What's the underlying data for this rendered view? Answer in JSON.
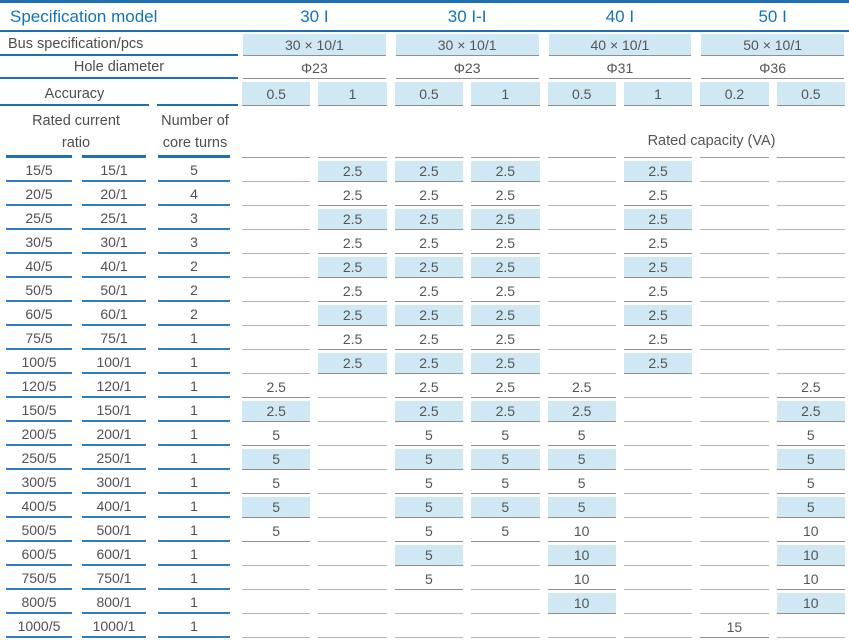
{
  "colors": {
    "accent_blue": "#1273b9",
    "line_blue": "#1f6fb2",
    "cell_bg": "#cfe8f3",
    "line_gray": "#8f8f8f",
    "line_gray_light": "#b5b5b5",
    "text_dark": "#4d4d4d"
  },
  "table": {
    "title": "Specification model",
    "models": [
      "30 I",
      "30 I-I",
      "40 I",
      "50 I"
    ],
    "bus_label": "Bus specification/pcs",
    "bus_values": [
      "30 × 10/1",
      "30 × 10/1",
      "40 × 10/1",
      "50 × 10/1"
    ],
    "hole_label": "Hole diameter",
    "hole_values": [
      "Φ23",
      "Φ23",
      "Φ31",
      "Φ36"
    ],
    "accuracy_label": "Accuracy",
    "accuracy_values": [
      "0.5",
      "1",
      "0.5",
      "1",
      "0.5",
      "1",
      "0.2",
      "0.5"
    ],
    "ratio_header": [
      "Rated current",
      "ratio"
    ],
    "turns_header": [
      "Number of",
      "core turns"
    ],
    "capacity_label": "Rated capacity (VA)",
    "rows": [
      {
        "ratio_5": "15/5",
        "ratio_1": "15/1",
        "turns": "5",
        "shaded": true,
        "capacities": [
          "",
          "2.5",
          "2.5",
          "2.5",
          "",
          "2.5",
          "",
          ""
        ]
      },
      {
        "ratio_5": "20/5",
        "ratio_1": "20/1",
        "turns": "4",
        "shaded": false,
        "capacities": [
          "",
          "2.5",
          "2.5",
          "2.5",
          "",
          "2.5",
          "",
          ""
        ]
      },
      {
        "ratio_5": "25/5",
        "ratio_1": "25/1",
        "turns": "3",
        "shaded": true,
        "capacities": [
          "",
          "2.5",
          "2.5",
          "2.5",
          "",
          "2.5",
          "",
          ""
        ]
      },
      {
        "ratio_5": "30/5",
        "ratio_1": "30/1",
        "turns": "3",
        "shaded": false,
        "capacities": [
          "",
          "2.5",
          "2.5",
          "2.5",
          "",
          "2.5",
          "",
          ""
        ]
      },
      {
        "ratio_5": "40/5",
        "ratio_1": "40/1",
        "turns": "2",
        "shaded": true,
        "capacities": [
          "",
          "2.5",
          "2.5",
          "2.5",
          "",
          "2.5",
          "",
          ""
        ]
      },
      {
        "ratio_5": "50/5",
        "ratio_1": "50/1",
        "turns": "2",
        "shaded": false,
        "capacities": [
          "",
          "2.5",
          "2.5",
          "2.5",
          "",
          "2.5",
          "",
          ""
        ]
      },
      {
        "ratio_5": "60/5",
        "ratio_1": "60/1",
        "turns": "2",
        "shaded": true,
        "capacities": [
          "",
          "2.5",
          "2.5",
          "2.5",
          "",
          "2.5",
          "",
          ""
        ]
      },
      {
        "ratio_5": "75/5",
        "ratio_1": "75/1",
        "turns": "1",
        "shaded": false,
        "capacities": [
          "",
          "2.5",
          "2.5",
          "2.5",
          "",
          "2.5",
          "",
          ""
        ]
      },
      {
        "ratio_5": "100/5",
        "ratio_1": "100/1",
        "turns": "1",
        "shaded": true,
        "capacities": [
          "",
          "2.5",
          "2.5",
          "2.5",
          "",
          "2.5",
          "",
          ""
        ]
      },
      {
        "ratio_5": "120/5",
        "ratio_1": "120/1",
        "turns": "1",
        "shaded": false,
        "capacities": [
          "2.5",
          "",
          "2.5",
          "2.5",
          "2.5",
          "",
          "",
          "2.5"
        ]
      },
      {
        "ratio_5": "150/5",
        "ratio_1": "150/1",
        "turns": "1",
        "shaded": true,
        "capacities": [
          "2.5",
          "",
          "2.5",
          "2.5",
          "2.5",
          "",
          "",
          "2.5"
        ]
      },
      {
        "ratio_5": "200/5",
        "ratio_1": "200/1",
        "turns": "1",
        "shaded": false,
        "capacities": [
          "5",
          "",
          "5",
          "5",
          "5",
          "",
          "",
          "5"
        ]
      },
      {
        "ratio_5": "250/5",
        "ratio_1": "250/1",
        "turns": "1",
        "shaded": true,
        "capacities": [
          "5",
          "",
          "5",
          "5",
          "5",
          "",
          "",
          "5"
        ]
      },
      {
        "ratio_5": "300/5",
        "ratio_1": "300/1",
        "turns": "1",
        "shaded": false,
        "capacities": [
          "5",
          "",
          "5",
          "5",
          "5",
          "",
          "",
          "5"
        ]
      },
      {
        "ratio_5": "400/5",
        "ratio_1": "400/1",
        "turns": "1",
        "shaded": true,
        "capacities": [
          "5",
          "",
          "5",
          "5",
          "5",
          "",
          "",
          "5"
        ]
      },
      {
        "ratio_5": "500/5",
        "ratio_1": "500/1",
        "turns": "1",
        "shaded": false,
        "capacities": [
          "5",
          "",
          "5",
          "5",
          "10",
          "",
          "",
          "10"
        ]
      },
      {
        "ratio_5": "600/5",
        "ratio_1": "600/1",
        "turns": "1",
        "shaded": true,
        "capacities": [
          "",
          "",
          "5",
          "",
          "10",
          "",
          "",
          "10"
        ]
      },
      {
        "ratio_5": "750/5",
        "ratio_1": "750/1",
        "turns": "1",
        "shaded": false,
        "capacities": [
          "",
          "",
          "5",
          "",
          "10",
          "",
          "",
          "10"
        ]
      },
      {
        "ratio_5": "800/5",
        "ratio_1": "800/1",
        "turns": "1",
        "shaded": true,
        "capacities": [
          "",
          "",
          "",
          "",
          "10",
          "",
          "",
          "10"
        ]
      },
      {
        "ratio_5": "1000/5",
        "ratio_1": "1000/1",
        "turns": "1",
        "shaded": false,
        "capacities": [
          "",
          "",
          "",
          "",
          "",
          "",
          "15",
          ""
        ]
      }
    ]
  }
}
